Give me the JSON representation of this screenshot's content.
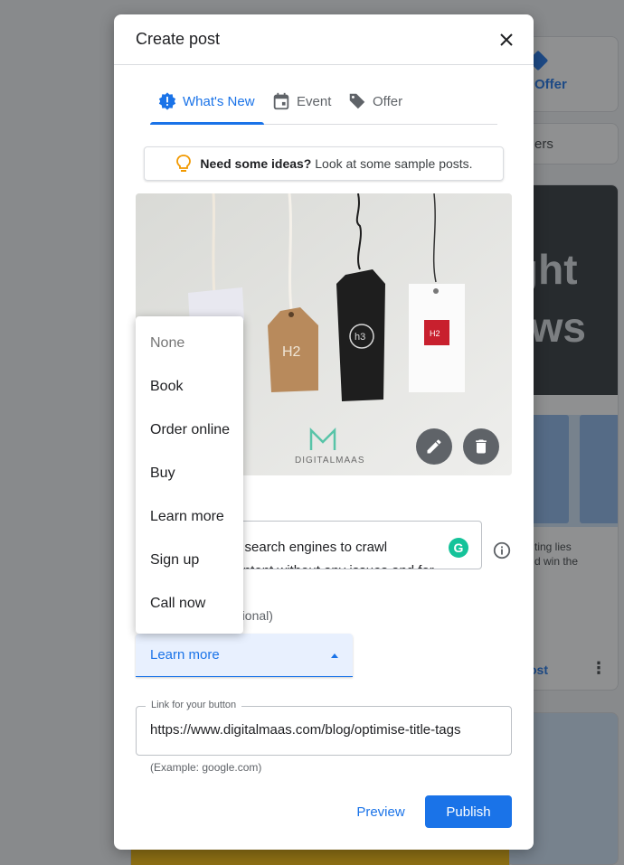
{
  "background": {
    "offer_label": "Offer",
    "chip_label": "ers",
    "post_big_1": "ght",
    "post_big_2": "ews",
    "post_snippet": "ting lies\nd win the",
    "post_link": "ost"
  },
  "dialog": {
    "title": "Create post",
    "tabs": [
      {
        "label": "What's New",
        "icon": "announcement-icon",
        "active": true
      },
      {
        "label": "Event",
        "icon": "calendar-icon",
        "active": false
      },
      {
        "label": "Offer",
        "icon": "tag-icon",
        "active": false
      }
    ],
    "ideas": {
      "bold": "Need some ideas?",
      "text": "Look at some sample posts."
    },
    "photo": {
      "tag_labels": [
        "H2",
        "h3",
        "H2"
      ],
      "brand": "DIGITALMAAS",
      "edit_icon": "pencil-icon",
      "delete_icon": "trash-icon"
    },
    "description": {
      "visible_text": "or search engines to crawl",
      "cut_text": "content without any issues and for"
    },
    "button_section_label": "ptional)",
    "button_select_value": "Learn more",
    "link": {
      "label": "Link for your button",
      "value": "https://www.digitalmaas.com/blog/optimise-title-tags",
      "hint": "(Example: google.com)"
    },
    "preview_label": "Preview",
    "publish_label": "Publish"
  },
  "menu": {
    "items": [
      "None",
      "Book",
      "Order online",
      "Buy",
      "Learn more",
      "Sign up",
      "Call now"
    ]
  },
  "colors": {
    "accent": "#1a73e8",
    "select_bg": "#e8f0fe",
    "grammarly": "#15c39a",
    "bulb": "#f29900"
  }
}
